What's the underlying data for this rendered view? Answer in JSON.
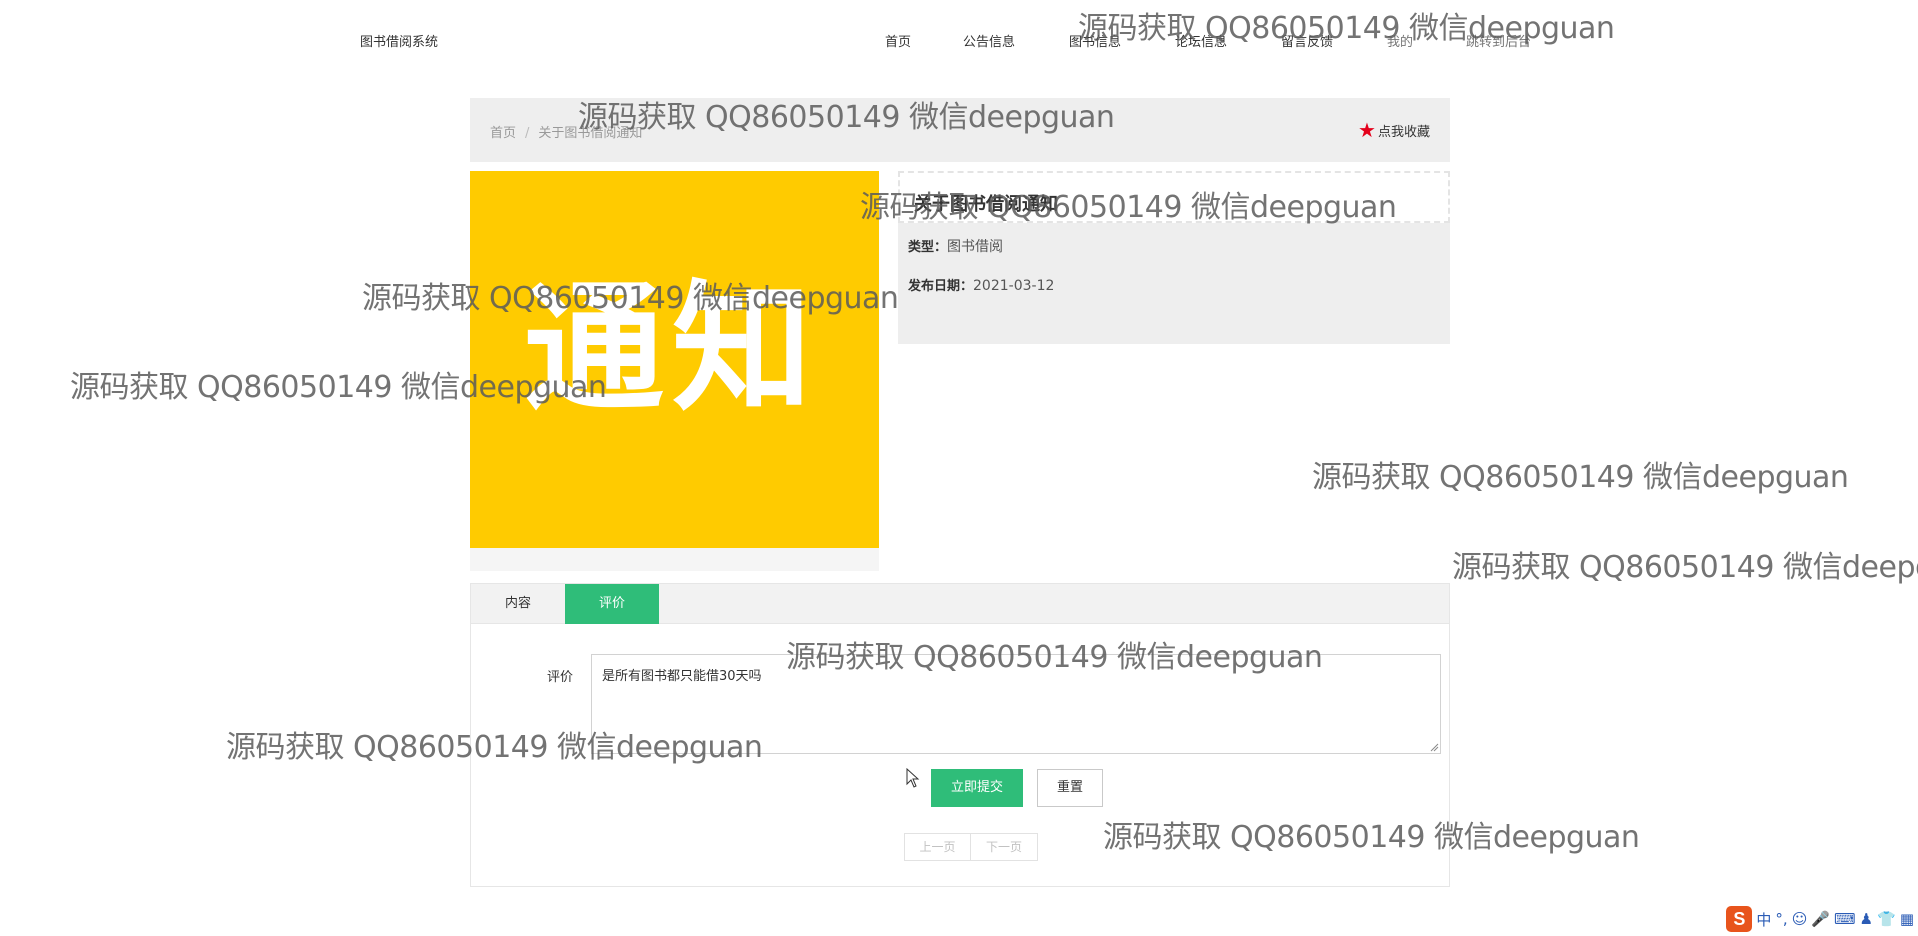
{
  "header": {
    "site_title": "图书借阅系统",
    "nav": [
      {
        "label": "首页"
      },
      {
        "label": "公告信息"
      },
      {
        "label": "图书信息"
      },
      {
        "label": "论坛信息"
      },
      {
        "label": "留言反馈"
      },
      {
        "label": "我的"
      },
      {
        "label": "跳转到后台"
      }
    ]
  },
  "breadcrumb": {
    "home": "首页",
    "separator": "/",
    "current": "关于图书借阅通知"
  },
  "favorite": {
    "label": "点我收藏",
    "icon": "star-icon",
    "icon_color": "#e4001b"
  },
  "poster": {
    "text": [
      "通",
      "知"
    ],
    "background": "#ffcb00"
  },
  "detail": {
    "title": "关于图书借阅通知",
    "type_label": "类型：",
    "type_value": "图书借阅",
    "date_label": "发布日期：",
    "date_value": "2021-03-12"
  },
  "tabs": [
    {
      "label": "内容",
      "active": false
    },
    {
      "label": "评价",
      "active": true
    }
  ],
  "comment_form": {
    "label": "评价",
    "value": "是所有图书都只能借30天吗",
    "submit_label": "立即提交",
    "reset_label": "重置"
  },
  "pager": {
    "prev": "上一页",
    "next": "下一页"
  },
  "watermark": "源码获取 QQ86050149 微信deepguan",
  "ime_tray": {
    "logo": "S",
    "items": [
      "中",
      "°,",
      "☺",
      "🎤",
      "⌨",
      "♟",
      "👕",
      "▦"
    ]
  },
  "colors": {
    "accent": "#2fbd79",
    "panel_bg": "#eeeeee"
  }
}
